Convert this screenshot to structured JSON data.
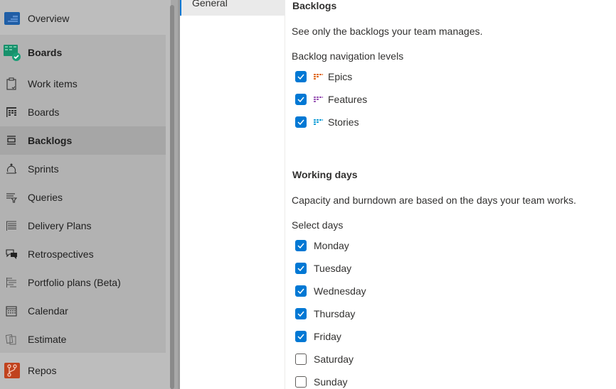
{
  "sidebar": {
    "items": [
      {
        "label": "Overview",
        "icon": "overview-icon",
        "type": "section"
      },
      {
        "label": "Boards",
        "icon": "boards-hub-icon",
        "type": "section"
      },
      {
        "label": "Work items",
        "icon": "work-items-icon",
        "type": "sub"
      },
      {
        "label": "Boards",
        "icon": "boards-icon",
        "type": "sub"
      },
      {
        "label": "Backlogs",
        "icon": "backlogs-icon",
        "type": "sub",
        "selected": true
      },
      {
        "label": "Sprints",
        "icon": "sprints-icon",
        "type": "sub"
      },
      {
        "label": "Queries",
        "icon": "queries-icon",
        "type": "sub"
      },
      {
        "label": "Delivery Plans",
        "icon": "delivery-plans-icon",
        "type": "sub"
      },
      {
        "label": "Retrospectives",
        "icon": "retrospectives-icon",
        "type": "sub"
      },
      {
        "label": "Portfolio plans (Beta)",
        "icon": "portfolio-plans-icon",
        "type": "sub"
      },
      {
        "label": "Calendar",
        "icon": "calendar-icon",
        "type": "sub"
      },
      {
        "label": "Estimate",
        "icon": "estimate-icon",
        "type": "sub"
      },
      {
        "label": "Repos",
        "icon": "repos-icon",
        "type": "section"
      }
    ]
  },
  "tabs": {
    "general_label": "General"
  },
  "backlogs": {
    "title": "Backlogs",
    "description": "See only the backlogs your team manages.",
    "levels_label": "Backlog navigation levels",
    "levels": [
      {
        "label": "Epics",
        "checked": true,
        "color": "#e06c1f"
      },
      {
        "label": "Features",
        "checked": true,
        "color": "#9b59b6"
      },
      {
        "label": "Stories",
        "checked": true,
        "color": "#1ba1d8"
      }
    ]
  },
  "working_days": {
    "title": "Working days",
    "description": "Capacity and burndown are based on the days your team works.",
    "select_label": "Select days",
    "days": [
      {
        "label": "Monday",
        "checked": true
      },
      {
        "label": "Tuesday",
        "checked": true
      },
      {
        "label": "Wednesday",
        "checked": true
      },
      {
        "label": "Thursday",
        "checked": true
      },
      {
        "label": "Friday",
        "checked": true
      },
      {
        "label": "Saturday",
        "checked": false
      },
      {
        "label": "Sunday",
        "checked": false
      }
    ]
  },
  "colors": {
    "accent": "#0078d4",
    "overview": "#1b5fa8",
    "boards": "#17916c",
    "repos": "#c0421d"
  }
}
